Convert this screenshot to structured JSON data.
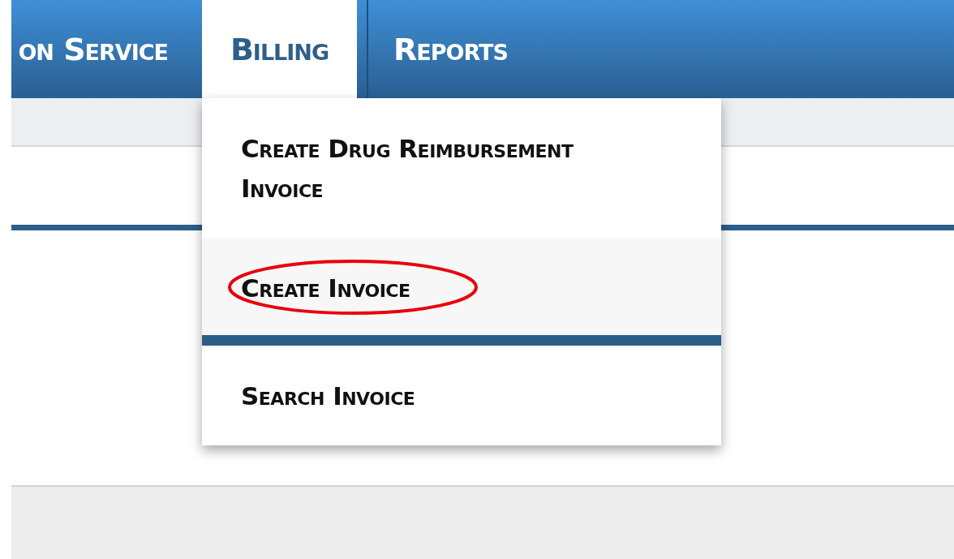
{
  "nav": {
    "tabs": [
      {
        "label": "on Service",
        "selected": false
      },
      {
        "label": "Billing",
        "selected": true
      },
      {
        "label": "Reports",
        "selected": false
      }
    ]
  },
  "menu": {
    "items": [
      {
        "label": "Create Drug Reimbursement Invoice",
        "selected": false,
        "circled": false
      },
      {
        "label": "Create Invoice",
        "selected": true,
        "circled": true
      },
      {
        "label": "Search Invoice",
        "selected": false,
        "circled": false
      }
    ]
  }
}
